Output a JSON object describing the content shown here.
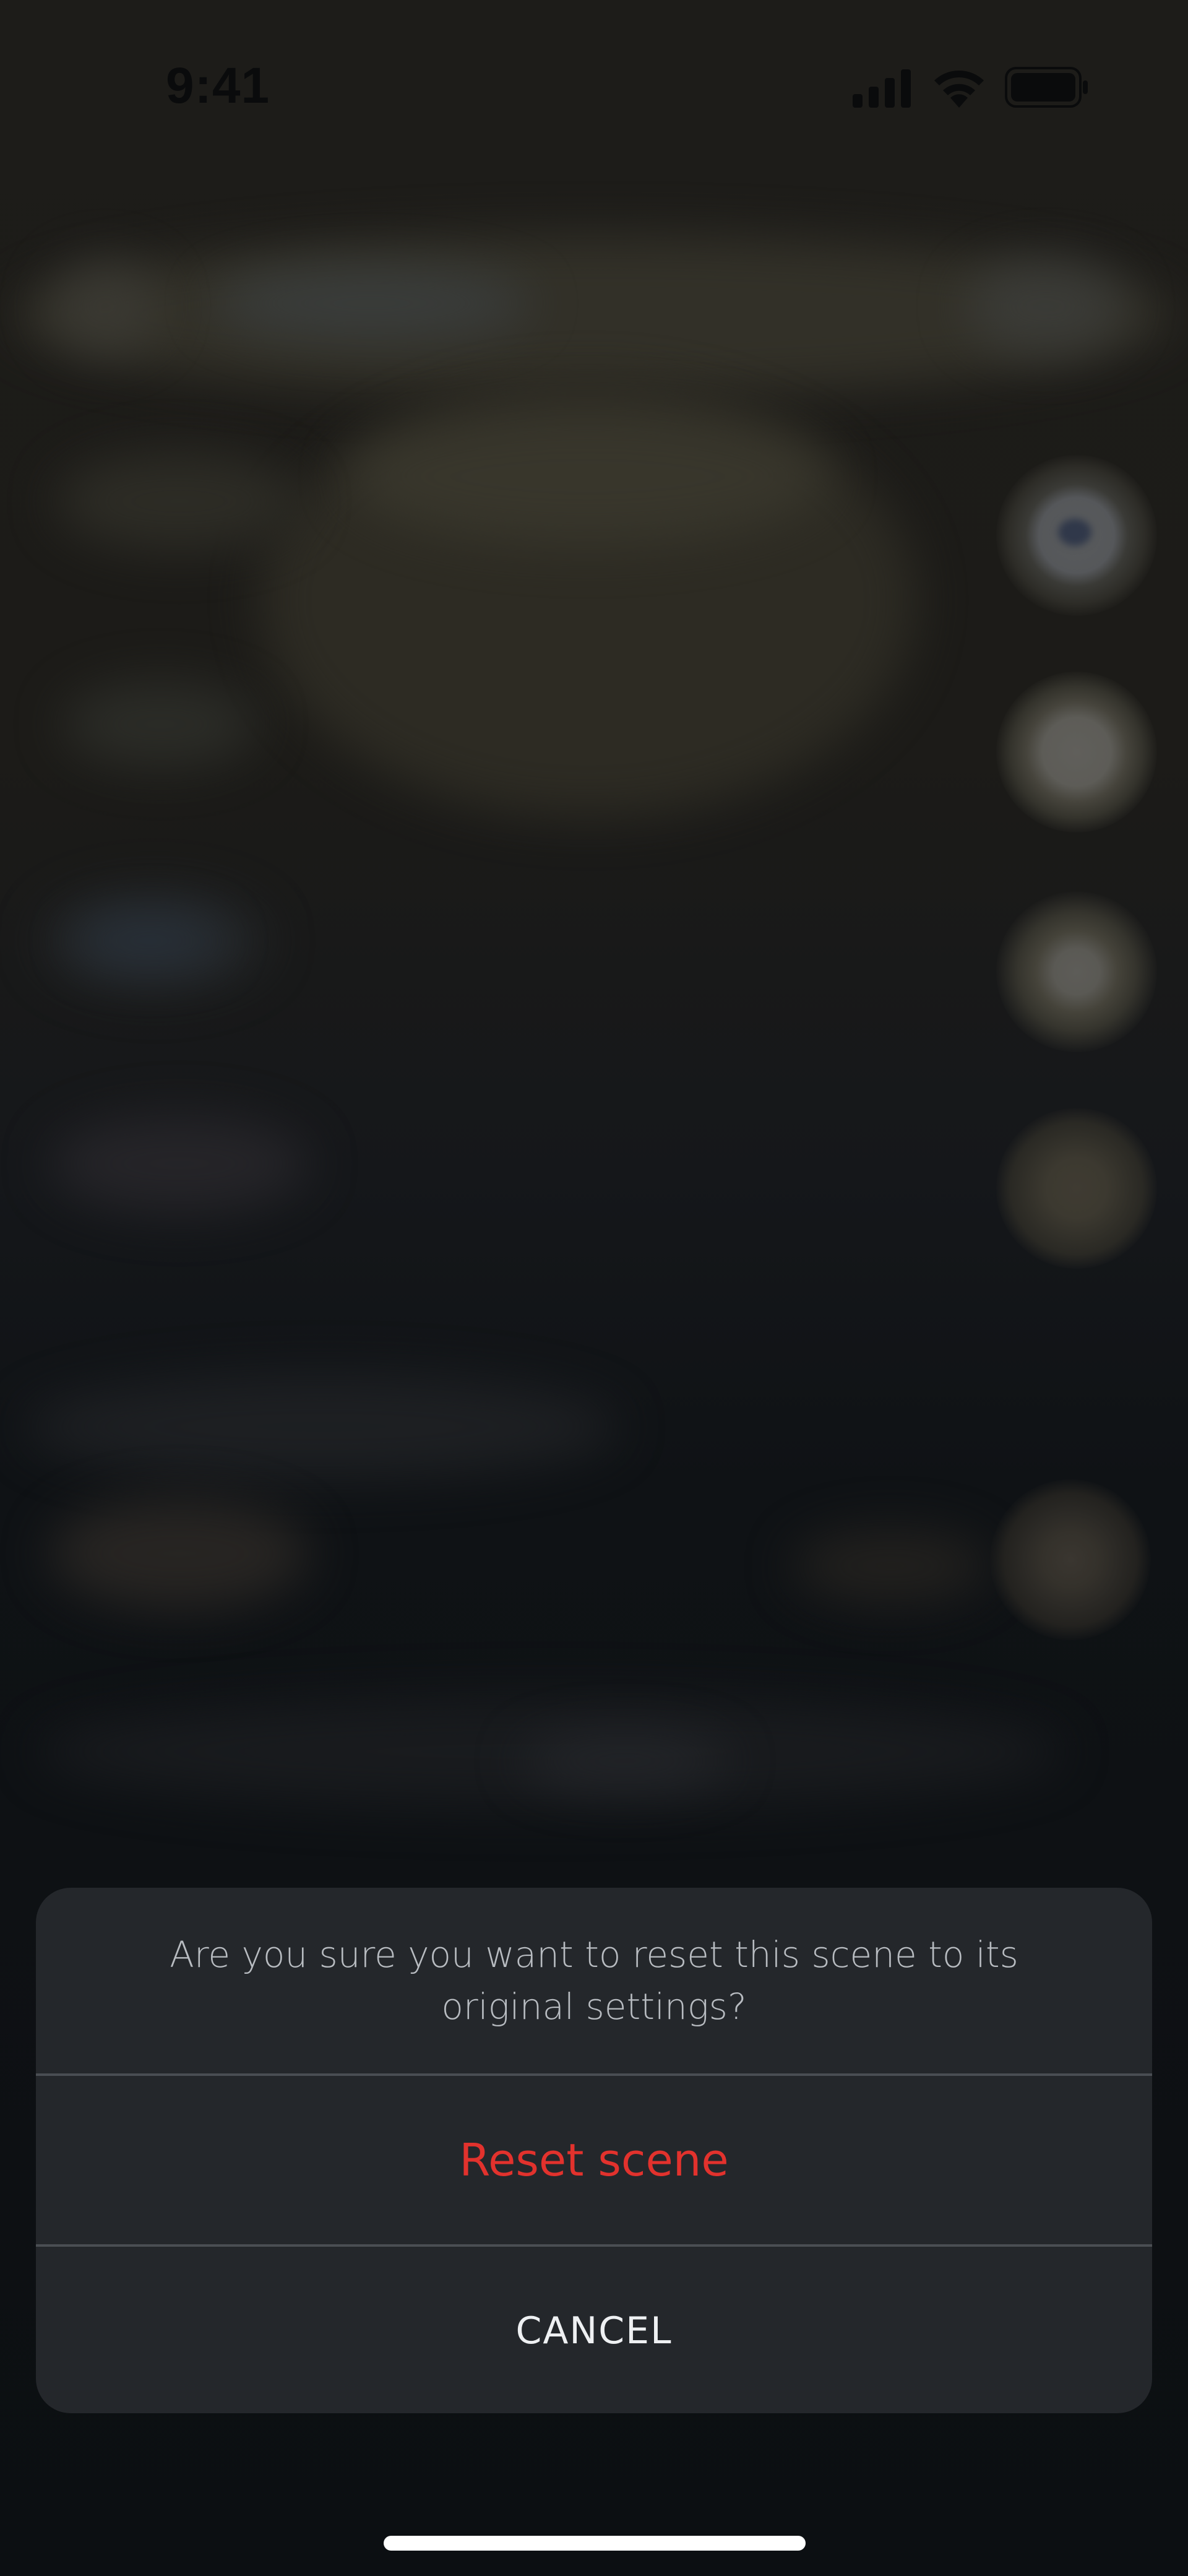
{
  "status_bar": {
    "time": "9:41",
    "icons": [
      "cellular-signal-icon",
      "wifi-icon",
      "battery-icon"
    ]
  },
  "action_sheet": {
    "message": "Are you sure you want to reset this scene to its original settings?",
    "destructive_label": "Reset scene",
    "cancel_label": "CANCEL"
  },
  "colors": {
    "destructive": "#e2322d",
    "sheet_background": "#24272b",
    "overlay_background": "#0c0f12"
  }
}
